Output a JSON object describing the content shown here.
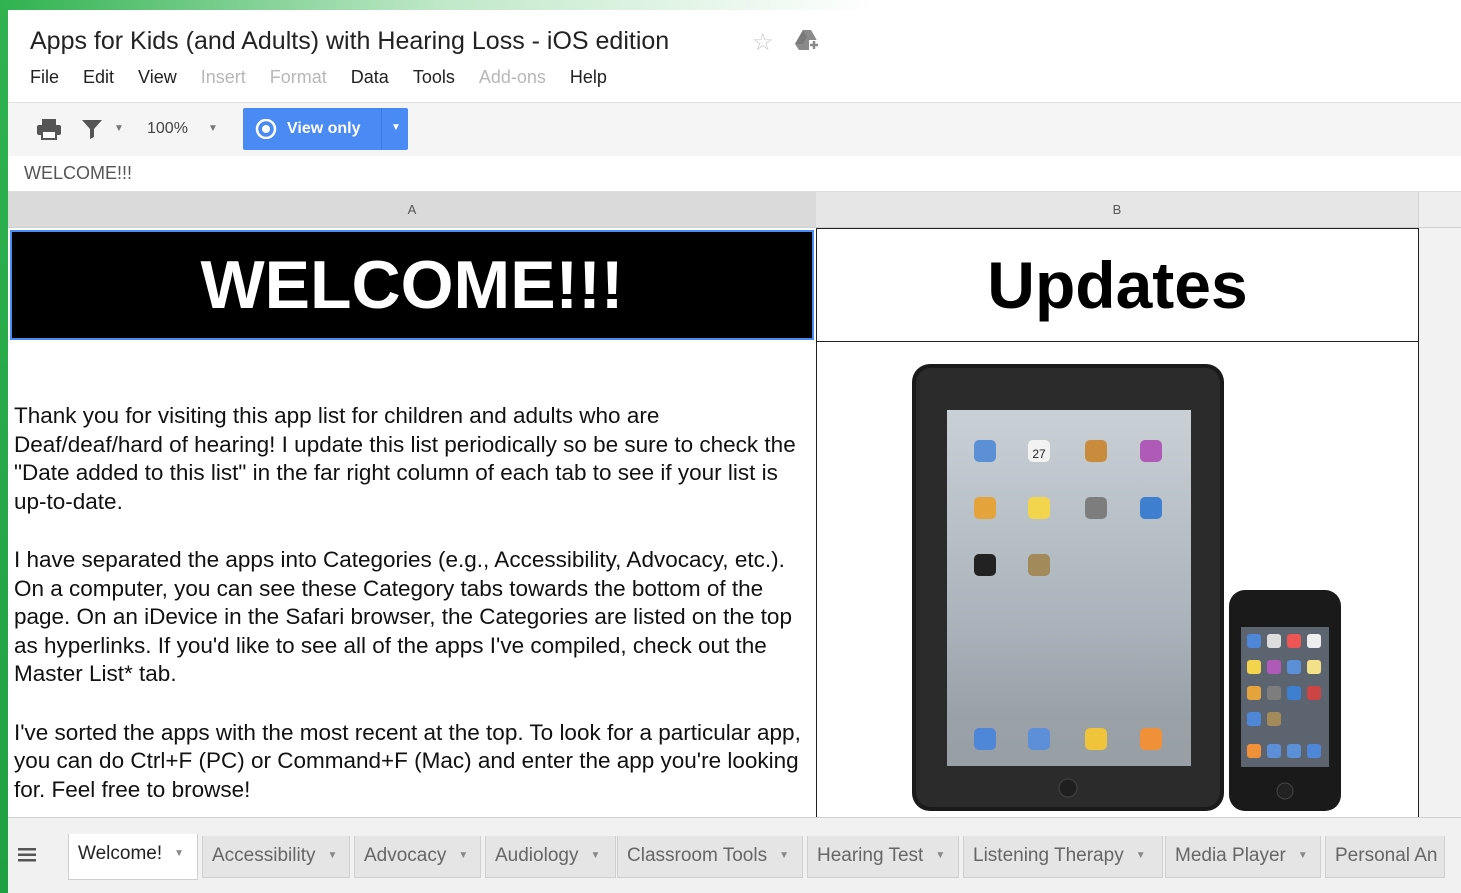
{
  "document": {
    "title": "Apps for Kids (and Adults) with Hearing Loss - iOS edition"
  },
  "menu": [
    "File",
    "Edit",
    "View",
    "Insert",
    "Format",
    "Data",
    "Tools",
    "Add-ons",
    "Help"
  ],
  "menu_disabled": [
    "Insert",
    "Format",
    "Add-ons"
  ],
  "toolbar": {
    "zoom": "100%",
    "view_only_label": "View only"
  },
  "formula_bar": {
    "value": "WELCOME!!!"
  },
  "columns": [
    "A",
    "B"
  ],
  "cells": {
    "a1": "WELCOME!!!",
    "b1": "Updates",
    "a2_paragraphs": [
      "Thank you for visiting this app list for children and adults who are Deaf/deaf/hard of hearing! I update this list periodically so be sure to check the \"Date added to this list\" in the far right column of each tab to see if your list is up-to-date.",
      "I have separated the apps into Categories (e.g., Accessibility, Advocacy, etc.).  On a computer, you can see these Category tabs towards the bottom of the page.   On an iDevice in the Safari browser, the Categories are listed on the top as hyperlinks. If you'd like to see all of the apps I've compiled, check out the Master List* tab.",
      "I've sorted the apps with the most recent at the top.  To look for a particular app, you can do Ctrl+F (PC) or Command+F (Mac) and enter the app you're looking for.  Feel free to browse!"
    ],
    "ipad_date": "27"
  },
  "sheet_tabs": [
    {
      "label": "Welcome!",
      "active": true
    },
    {
      "label": "Accessibility"
    },
    {
      "label": "Advocacy"
    },
    {
      "label": "Audiology"
    },
    {
      "label": "Classroom Tools"
    },
    {
      "label": "Hearing Test"
    },
    {
      "label": "Listening Therapy"
    },
    {
      "label": "Media Player"
    },
    {
      "label": "Personal An"
    }
  ],
  "colors": {
    "accent": "#4a8af4",
    "brand_green": "#2fb24f"
  }
}
